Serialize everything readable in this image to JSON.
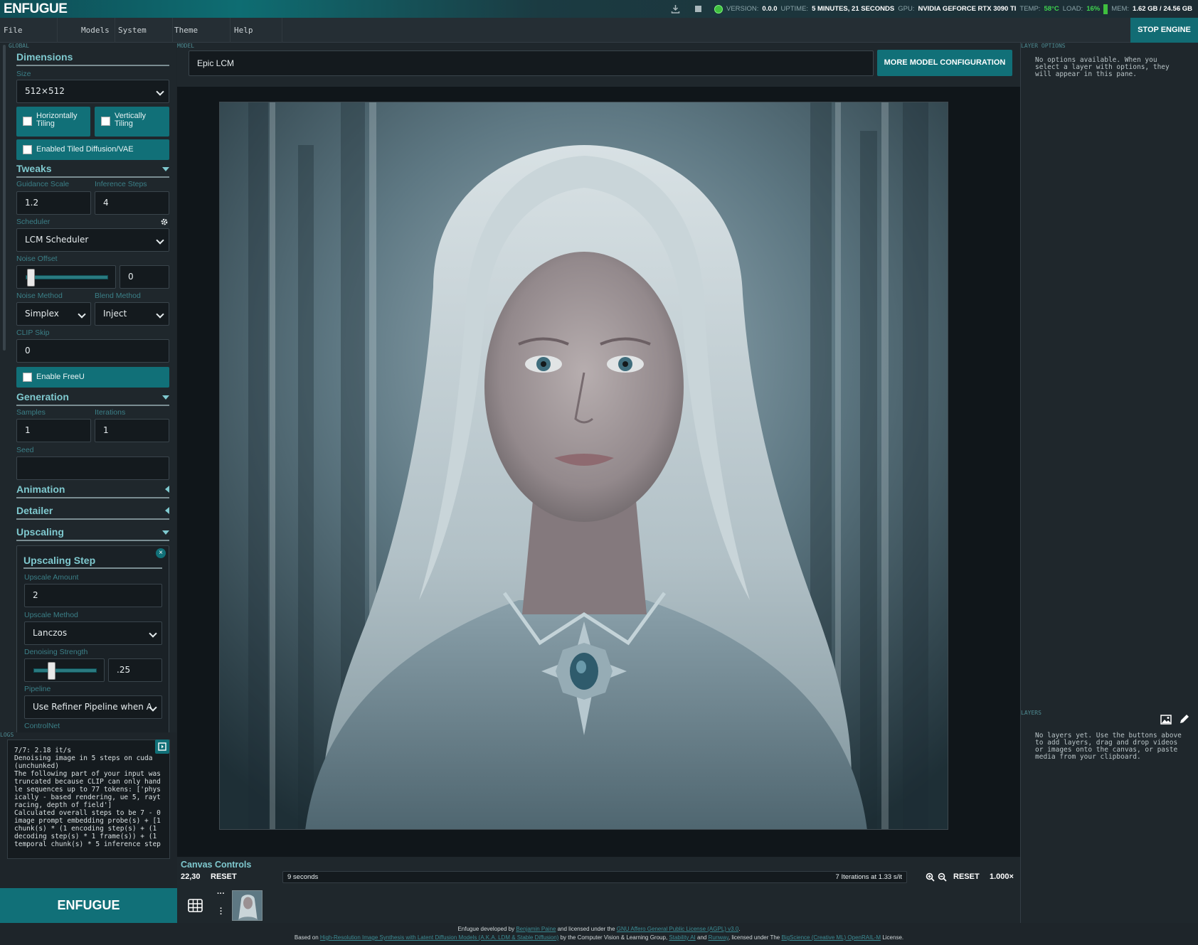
{
  "header": {
    "logo": "ENFUGUE",
    "status": {
      "version_label": "VERSION:",
      "version": "0.0.0",
      "uptime_label": "UPTIME:",
      "uptime": "5 MINUTES, 21 SECONDS",
      "gpu_label": "GPU:",
      "gpu": "NVIDIA GEFORCE RTX 3090 TI",
      "temp_label": "TEMP:",
      "temp": "58°C",
      "load_label": "LOAD:",
      "load": "16%",
      "mem_label": "MEM:",
      "mem": "1.62 GB / 24.56 GB"
    }
  },
  "menu": {
    "items": [
      "File",
      "Models",
      "System",
      "Theme",
      "Help"
    ],
    "stop_engine": "STOP ENGINE"
  },
  "left": {
    "global_label": "GLOBAL",
    "dimensions": {
      "title": "Dimensions",
      "size_label": "Size",
      "size_value": "512×512",
      "h_tiling": "Horizontally Tiling",
      "v_tiling": "Vertically Tiling",
      "tiled_diffusion": "Enabled Tiled Diffusion/VAE"
    },
    "tweaks": {
      "title": "Tweaks",
      "guidance_label": "Guidance Scale",
      "guidance_value": "1.2",
      "steps_label": "Inference Steps",
      "steps_value": "4",
      "scheduler_label": "Scheduler",
      "scheduler_value": "LCM Scheduler",
      "noise_offset_label": "Noise Offset",
      "noise_offset_value": "0",
      "noise_offset_fraction": 0.0,
      "noise_method_label": "Noise Method",
      "noise_method_value": "Simplex",
      "blend_method_label": "Blend Method",
      "blend_method_value": "Inject",
      "clip_skip_label": "CLIP Skip",
      "clip_skip_value": "0",
      "freeu": "Enable FreeU"
    },
    "generation": {
      "title": "Generation",
      "samples_label": "Samples",
      "samples_value": "1",
      "iterations_label": "Iterations",
      "iterations_value": "1",
      "seed_label": "Seed",
      "seed_value": ""
    },
    "animation_title": "Animation",
    "detailer_title": "Detailer",
    "upscaling": {
      "title": "Upscaling",
      "step_title": "Upscaling Step",
      "amount_label": "Upscale Amount",
      "amount_value": "2",
      "method_label": "Upscale Method",
      "method_value": "Lanczos",
      "denoise_label": "Denoising Strength",
      "denoise_value": ".25",
      "denoise_fraction": 0.25,
      "pipeline_label": "Pipeline",
      "pipeline_value": "Use Refiner Pipeline when A",
      "controlnet_label": "ControlNet"
    },
    "logs_label": "LOGS",
    "logs": "7/7: 2.18 it/s\nDenoising image in 5 steps on cuda (unchunked)\nThe following part of your input was truncated because CLIP can only handle sequences up to 77 tokens: ['physically - based rendering, ue 5, raytracing, depth of field']\nCalculated overall steps to be 7 - 0 image prompt embedding probe(s) + [1 chunk(s) * (1 encoding step(s) + (1 decoding step(s) * 1 frame(s)) + (1 temporal chunk(s) * 5 inference step",
    "brand": "ENFUGUE"
  },
  "model": {
    "label": "MODEL",
    "value": "Epic LCM",
    "button": "MORE MODEL CONFIGURATION"
  },
  "canvas_controls": {
    "title": "Canvas Controls",
    "coords": "22,30",
    "reset_left": "RESET",
    "elapsed": "9 seconds",
    "iterations": "7 Iterations at 1.33 s/it",
    "reset_right": "RESET",
    "zoom": "1.000×"
  },
  "right": {
    "layer_options_label": "LAYER OPTIONS",
    "layer_options_text": "No options available. When you select a layer with options, they will appear in this pane.",
    "layers_label": "LAYERS",
    "layers_text": "No layers yet. Use the buttons above to add layers, drag and drop videos or images onto the canvas, or paste media from your clipboard."
  },
  "footer": {
    "line1_a": "Enfugue developed by",
    "author": "Benjamin Paine",
    "line1_b": "and licensed under the",
    "license": "GNU Affero General Public License (AGPL) v3.0",
    "line1_c": ".",
    "line2_a": "Based on",
    "paper": "High-Resolution Image Synthesis with Latent Diffusion Models (A.K.A. LDM & Stable Diffusion)",
    "line2_b": "by the Computer Vision & Learning Group,",
    "stability": "Stability AI",
    "and": "and",
    "runway": "Runway",
    "line2_c": ", licensed under The",
    "openrail": "BigScience (Creative ML) OpenRAIL-M",
    "line2_d": "License."
  }
}
